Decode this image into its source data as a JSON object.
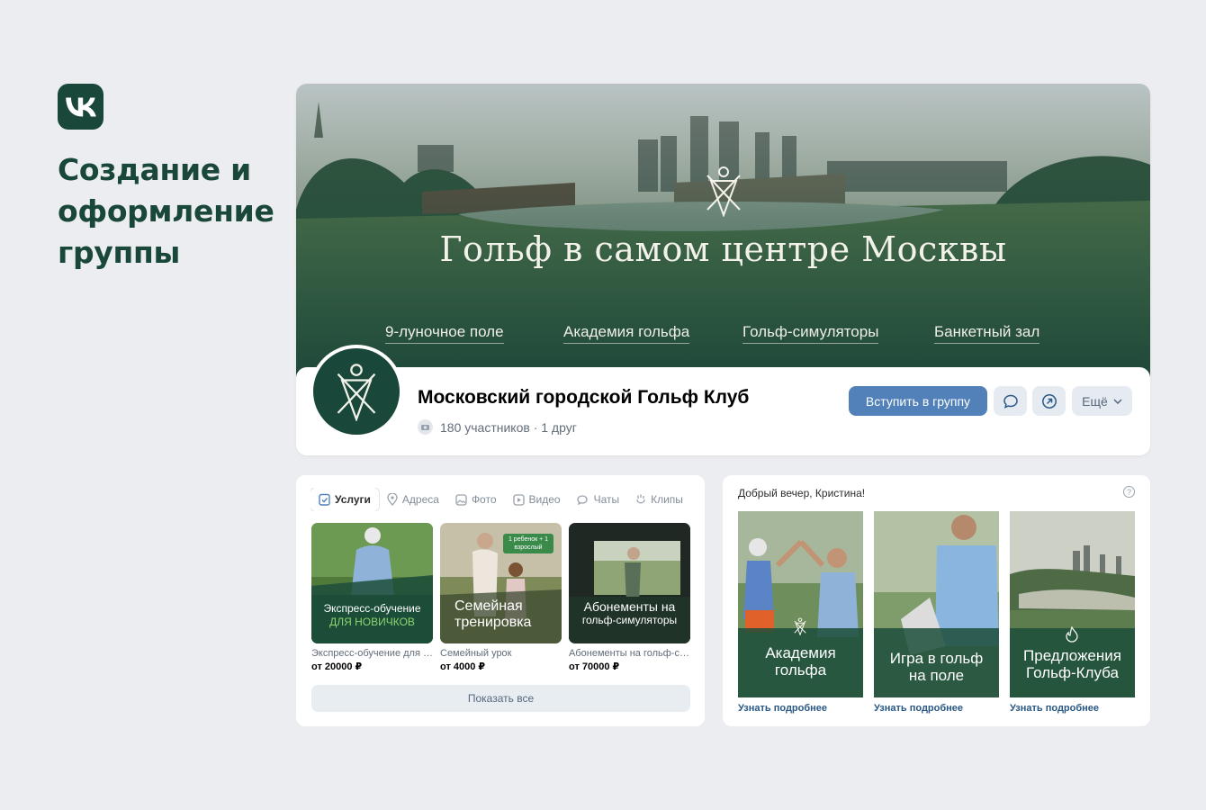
{
  "brand": {
    "logo_icon": "vk-logo-icon",
    "headline_lines": [
      "Создание и",
      "оформление",
      "группы"
    ],
    "color": "#19473a"
  },
  "cover": {
    "title": "Гольф в самом центре Москвы",
    "nav": [
      "9-луночное поле",
      "Академия гольфа",
      "Гольф-симуляторы",
      "Банкетный зал"
    ]
  },
  "community": {
    "name": "Московский городской Гольф Клуб",
    "members": "180 участников · 1 друг",
    "join_label": "Вступить в группу",
    "more_label": "Ещё",
    "join_color": "#5181b8"
  },
  "services": {
    "tabs": [
      {
        "label": "Услуги",
        "icon": "checklist-icon",
        "active": true
      },
      {
        "label": "Адреса",
        "icon": "location-pin-icon",
        "active": false
      },
      {
        "label": "Фото",
        "icon": "photo-icon",
        "active": false
      },
      {
        "label": "Видео",
        "icon": "video-icon",
        "active": false
      },
      {
        "label": "Чаты",
        "icon": "chat-icon",
        "active": false
      },
      {
        "label": "Клипы",
        "icon": "clip-icon",
        "active": false
      }
    ],
    "items": [
      {
        "overlay_line1": "Экспресс-обучение",
        "overlay_line2": "ДЛЯ НОВИЧКОВ",
        "title": "Экспресс-обучение для новичков",
        "price": "от 20000 ₽"
      },
      {
        "badge": "1 ребенок + 1 взрослый",
        "overlay_line1": "Семейная",
        "overlay_line2": "тренировка",
        "title": "Семейный урок",
        "price": "от 4000 ₽"
      },
      {
        "overlay_line1": "Абонементы на",
        "overlay_line2": "гольф-симуляторы",
        "title": "Абонементы на гольф-симуляторы",
        "price": "от 70000 ₽"
      }
    ],
    "show_all": "Показать все"
  },
  "greeting": {
    "title": "Добрый вечер, Кристина!",
    "help": "?",
    "promos": [
      {
        "line1": "Академия",
        "line2": "гольфа",
        "link": "Узнать подробнее"
      },
      {
        "line1": "Игра в гольф",
        "line2": "на поле",
        "link": "Узнать подробнее"
      },
      {
        "line1": "Предложения",
        "line2": "Гольф-Клуба",
        "link": "Узнать подробнее"
      }
    ]
  }
}
